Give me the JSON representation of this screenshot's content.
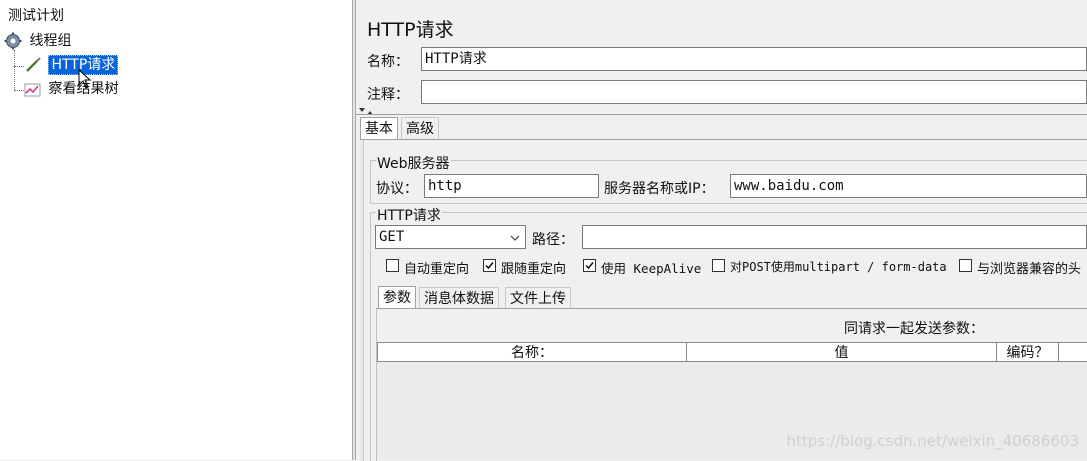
{
  "tree": {
    "root": "测试计划",
    "thread_group": "线程组",
    "http_request": "HTTP请求",
    "view_results": "察看结果树"
  },
  "panel": {
    "title": "HTTP请求",
    "name_label": "名称：",
    "name_value": "HTTP请求",
    "comment_label": "注释：",
    "comment_value": ""
  },
  "tabs": {
    "basic": "基本",
    "advanced": "高级"
  },
  "web_server": {
    "group_title": "Web服务器",
    "protocol_label": "协议：",
    "protocol_value": "http",
    "server_label": "服务器名称或IP：",
    "server_value": "www.baidu.com"
  },
  "http_request": {
    "group_title": "HTTP请求",
    "method": "GET",
    "path_label": "路径：",
    "path_value": ""
  },
  "options": [
    {
      "label": "自动重定向",
      "checked": false
    },
    {
      "label": "跟随重定向",
      "checked": true
    },
    {
      "label": "使用 KeepAlive",
      "checked": true
    },
    {
      "label": "对POST使用multipart / form-data",
      "checked": false
    },
    {
      "label": "与浏览器兼容的头",
      "checked": false
    }
  ],
  "param_tabs": [
    "参数",
    "消息体数据",
    "文件上传"
  ],
  "params": {
    "caption": "同请求一起发送参数：",
    "columns": [
      "名称：",
      "值",
      "编码？"
    ]
  },
  "watermark": "https://blog.csdn.net/weixin_40686603"
}
